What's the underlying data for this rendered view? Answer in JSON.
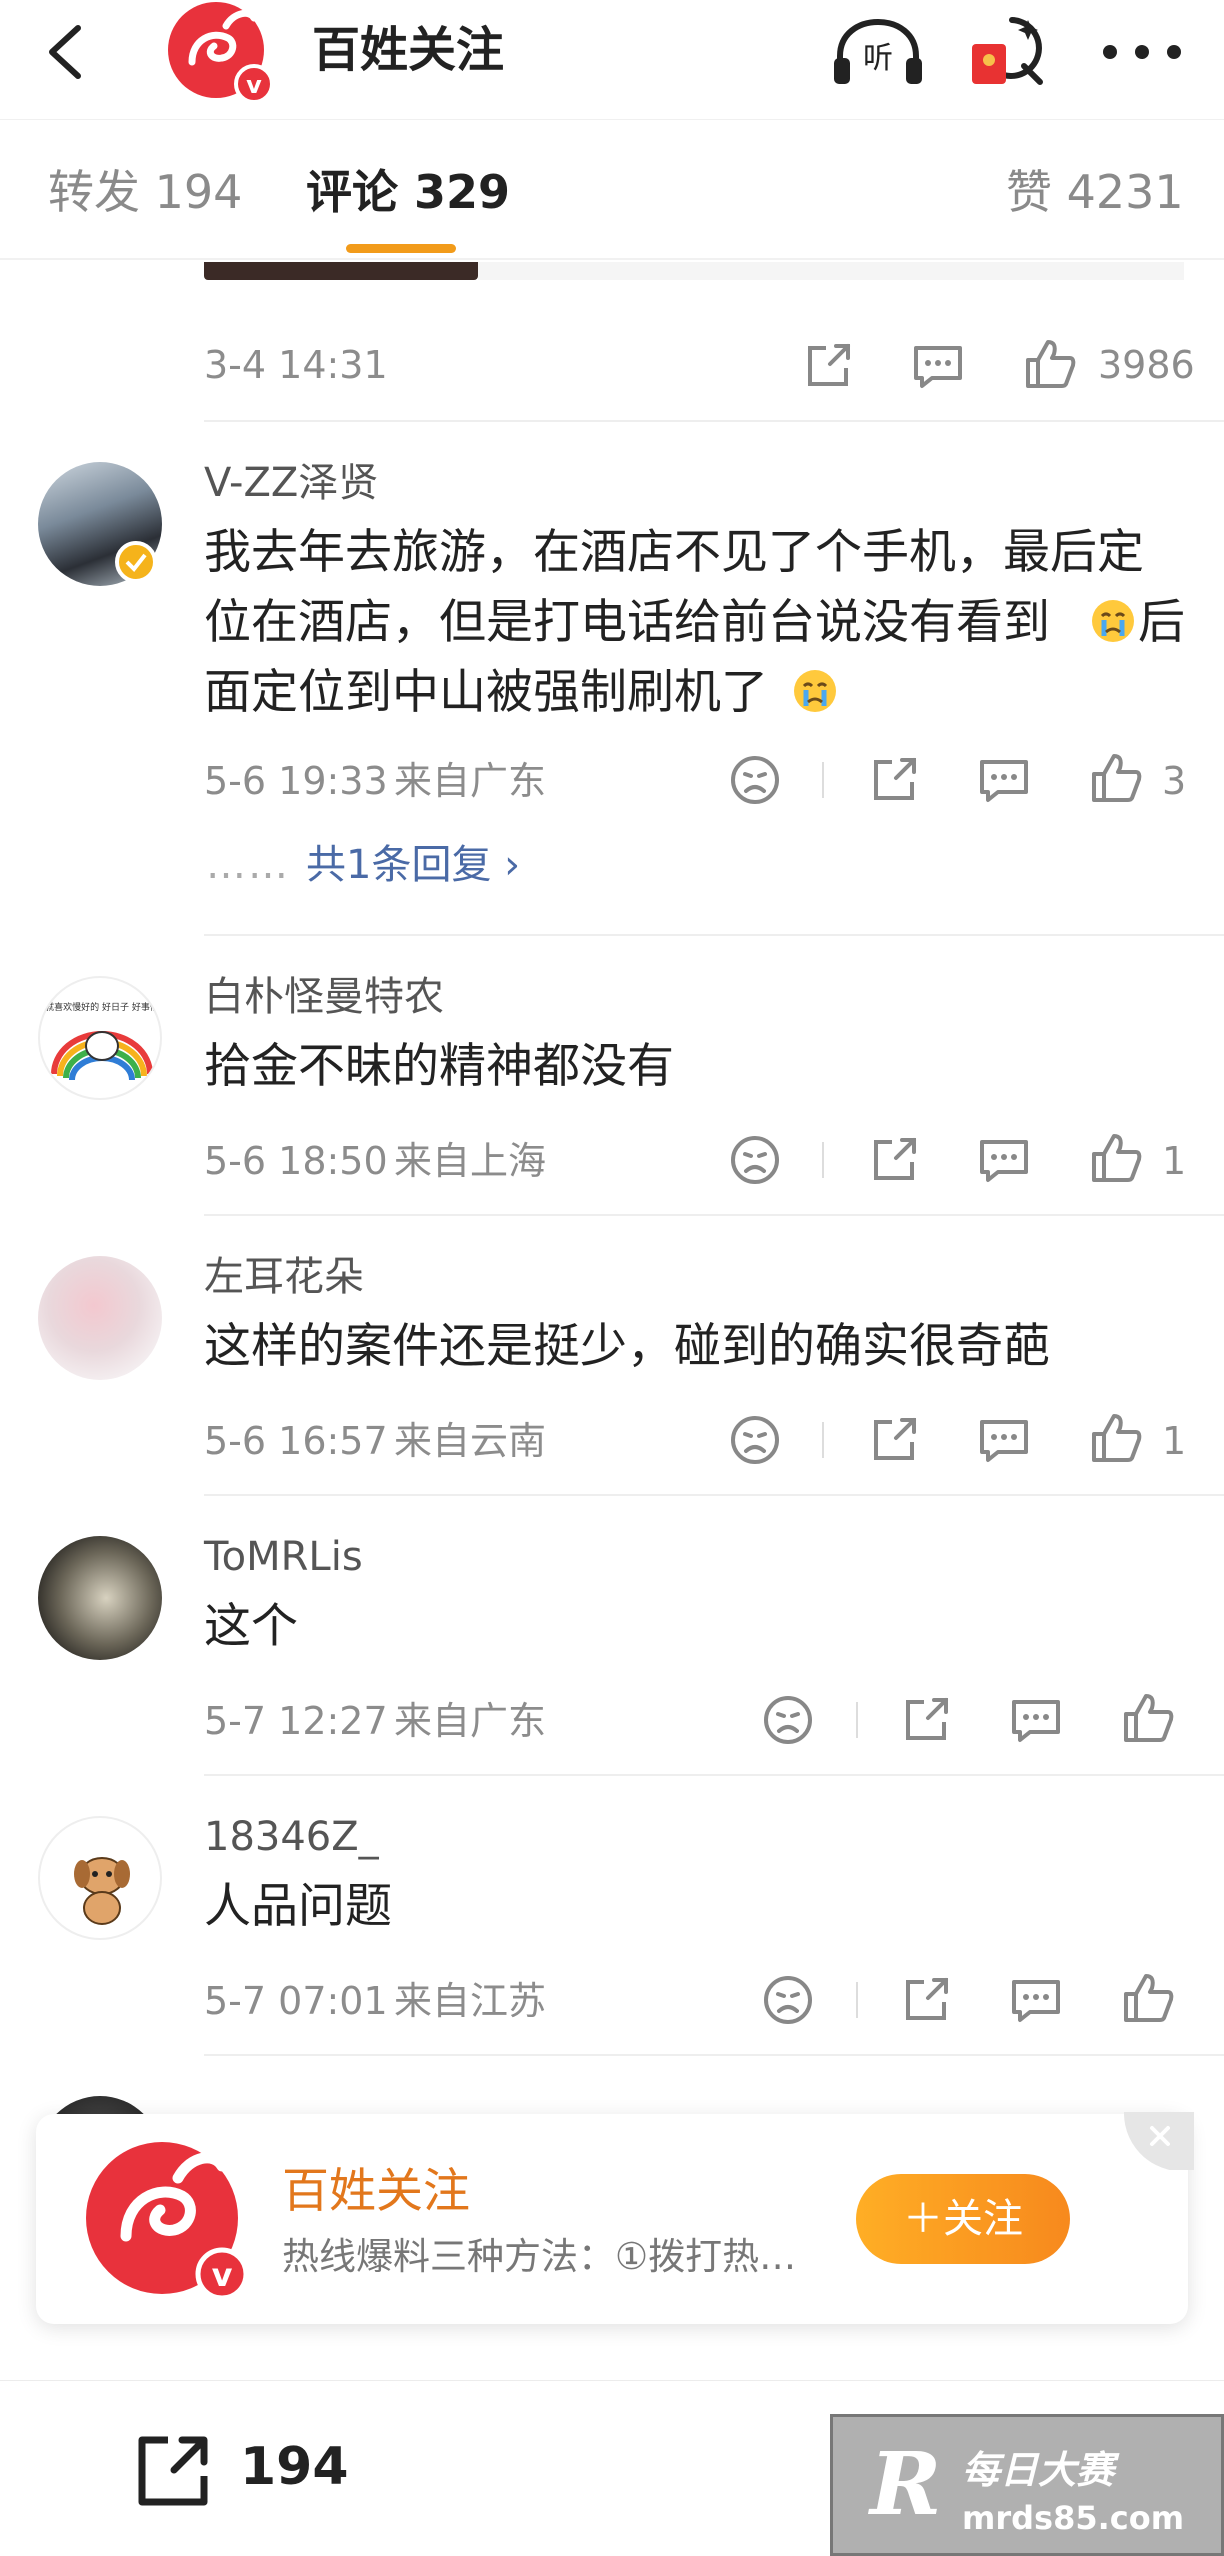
{
  "header": {
    "title": "百姓关注",
    "listen_label": "听"
  },
  "tabs": {
    "repost_label": "转发",
    "repost_count": "194",
    "comment_label": "评论",
    "comment_count": "329",
    "like_label": "赞",
    "like_count": "4231"
  },
  "top_meta": {
    "time": "3-4 14:31",
    "likes": "3986"
  },
  "comments": [
    {
      "user": "V-ZZ泽贤",
      "text1": "我去年去旅游，在酒店不见了个手机，最后定",
      "text2": "位在酒店，但是打电话给前台说没有看到",
      "text3": "后",
      "text4": "面定位到中山被强制刷机了",
      "time": "5-6 19:33",
      "location": "来自广东",
      "likes": "3",
      "reply_dots": "……",
      "reply_label": "共1条回复 ›"
    },
    {
      "user": "白朴怪曼特农",
      "text": "拾金不昧的精神都没有",
      "time": "5-6 18:50",
      "location": "来自上海",
      "likes": "1",
      "avatar_text": "就喜欢慢好的 好日子 好事情"
    },
    {
      "user": "左耳花朵",
      "text": "这样的案件还是挺少，碰到的确实很奇葩",
      "time": "5-6 16:57",
      "location": "来自云南",
      "likes": "1"
    },
    {
      "user": "ToMRLis",
      "text": "这个",
      "time": "5-7 12:27",
      "location": "来自广东",
      "likes": ""
    },
    {
      "user": "18346Z_",
      "text": "人品问题",
      "time": "5-7 07:01",
      "location": "来自江苏",
      "likes": ""
    }
  ],
  "card": {
    "name": "百姓关注",
    "desc": "热线爆料三种方法：①拨打热…",
    "follow_label": "＋关注"
  },
  "bottom": {
    "share_count": "194"
  },
  "watermark": {
    "r": "R",
    "cn": "每日大赛",
    "url": "mrds85.com"
  },
  "colors": {
    "accent": "#f29b1a",
    "brand_red": "#e8323c",
    "link": "#4a6aa6",
    "follow": "#f7891d"
  }
}
